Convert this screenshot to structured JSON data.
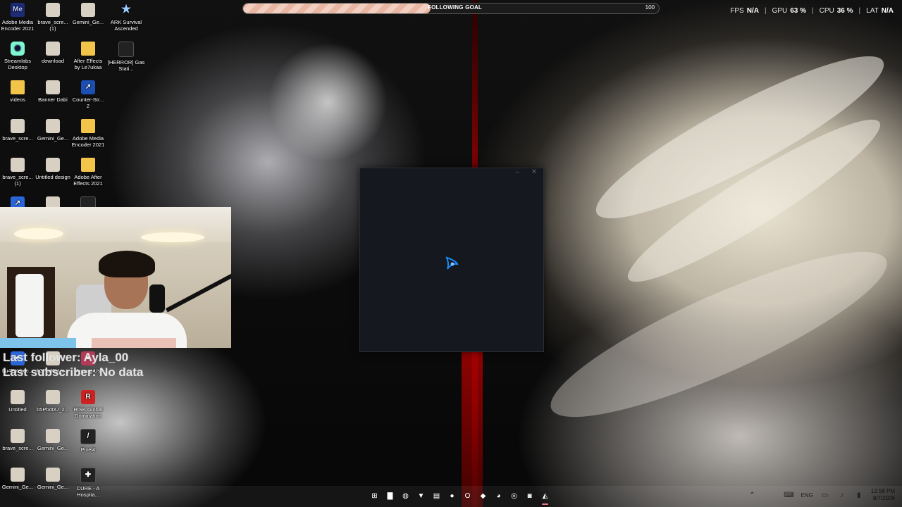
{
  "follow_goal": {
    "label": "FOLLOWING GOAL",
    "target": "100",
    "progress_fraction": 0.45
  },
  "stats": {
    "fps_label": "FPS",
    "fps_value": "N/A",
    "gpu_label": "GPU",
    "gpu_value": "63 %",
    "cpu_label": "CPU",
    "cpu_value": "36 %",
    "lat_label": "LAT",
    "lat_value": "N/A",
    "separator": "|"
  },
  "desktop_icons": [
    {
      "label": "Adobe Media Encoder 2021",
      "icon": "adobe-media-encoder-icon",
      "glyph": "Me"
    },
    {
      "label": "brave_scre... (1)",
      "icon": "image-file-icon",
      "glyph": ""
    },
    {
      "label": "Gemini_Ge...",
      "icon": "image-file-icon",
      "glyph": ""
    },
    {
      "label": "ARK Survival Ascended",
      "icon": "ark-game-icon",
      "glyph": "★"
    },
    {
      "label": "Streamlabs Desktop",
      "icon": "streamlabs-icon",
      "glyph": "◉"
    },
    {
      "label": "download",
      "icon": "image-file-icon",
      "glyph": ""
    },
    {
      "label": "After Effects by Le7ukaa",
      "icon": "folder-icon",
      "glyph": ""
    },
    {
      "label": "[HERROR] Gas Stati...",
      "icon": "game-icon",
      "glyph": ""
    },
    {
      "label": "videos",
      "icon": "folder-icon",
      "glyph": ""
    },
    {
      "label": "Banner Dabi",
      "icon": "image-file-icon",
      "glyph": ""
    },
    {
      "label": "Counter-Str... 2",
      "icon": "counter-strike-icon",
      "glyph": "↗"
    },
    {
      "label": "brave_scre...",
      "icon": "image-file-icon",
      "glyph": ""
    },
    {
      "label": "Gemini_Ge...",
      "icon": "image-file-icon",
      "glyph": ""
    },
    {
      "label": "Adobe Media Encoder 2021",
      "icon": "folder-icon",
      "glyph": ""
    },
    {
      "label": "brave_scre... (1)",
      "icon": "image-file-icon",
      "glyph": ""
    },
    {
      "label": "Untitled design",
      "icon": "image-file-icon",
      "glyph": ""
    },
    {
      "label": "Adobe After Effects 2021",
      "icon": "folder-icon",
      "glyph": ""
    },
    {
      "label": "",
      "icon": "app-shortcut-icon",
      "glyph": "↗"
    },
    {
      "label": "",
      "icon": "image-file-icon",
      "glyph": ""
    },
    {
      "label": "",
      "icon": "game-icon",
      "glyph": ""
    },
    {
      "label": "Lu4PYekoc...",
      "icon": "app-shortcut-icon",
      "glyph": "◐"
    },
    {
      "label": "h3Pbd0U_c...",
      "icon": "image-file-icon",
      "glyph": ""
    },
    {
      "label": "Among Us",
      "icon": "among-us-icon",
      "glyph": "●"
    },
    {
      "label": "Untitled",
      "icon": "image-file-icon",
      "glyph": ""
    },
    {
      "label": "b5Pbd0U_2...",
      "icon": "image-file-icon",
      "glyph": ""
    },
    {
      "label": "RISK Global Domination",
      "icon": "risk-game-icon",
      "glyph": "R"
    },
    {
      "label": "brave_scre...",
      "icon": "image-file-icon",
      "glyph": ""
    },
    {
      "label": "Gemini_Ge...",
      "icon": "image-file-icon",
      "glyph": ""
    },
    {
      "label": "Pixel4",
      "icon": "game-icon",
      "glyph": "/"
    },
    {
      "label": "Gemini_Ge...",
      "icon": "image-file-icon",
      "glyph": ""
    },
    {
      "label": "Gemini_Ge...",
      "icon": "image-file-icon",
      "glyph": ""
    },
    {
      "label": "CURE - A Hospita...",
      "icon": "game-icon",
      "glyph": "✚"
    }
  ],
  "stream_overlay": {
    "last_follower": "Last follower: Ayla_00",
    "last_subscriber": "Last subscriber: No data"
  },
  "loader_window": {
    "minimize_glyph": "–",
    "close_glyph": "✕",
    "logo": "battle-net-logo-icon",
    "accent": "#148eff"
  },
  "taskbar": {
    "items": [
      {
        "icon": "windows-start-icon",
        "glyph": "⊞"
      },
      {
        "icon": "file-explorer-icon",
        "glyph": "▇"
      },
      {
        "icon": "copilot-icon",
        "glyph": "◍"
      },
      {
        "icon": "brave-browser-icon",
        "glyph": "▼"
      },
      {
        "icon": "notepad-icon",
        "glyph": "▤"
      },
      {
        "icon": "spotify-icon",
        "glyph": "●"
      },
      {
        "icon": "outlook-icon",
        "glyph": "O"
      },
      {
        "icon": "app-icon",
        "glyph": "◆"
      },
      {
        "icon": "discord-icon",
        "glyph": "◕"
      },
      {
        "icon": "obs-icon",
        "glyph": "◎"
      },
      {
        "icon": "streamlabs-icon",
        "glyph": "◙"
      },
      {
        "icon": "battle-net-icon",
        "glyph": "◭"
      }
    ],
    "tray": {
      "chevron": "⌃",
      "keyboard_glyph": "⌨",
      "language": "ENG",
      "network_glyph": "▭",
      "volume_glyph": "♪",
      "battery_glyph": "▮"
    },
    "time": "12:58 PM",
    "date": "8/7/2026"
  },
  "colors": {
    "goal_fill": "#e8b7a4",
    "red_accent": "#c40000",
    "loader_bg": "#15181e"
  }
}
